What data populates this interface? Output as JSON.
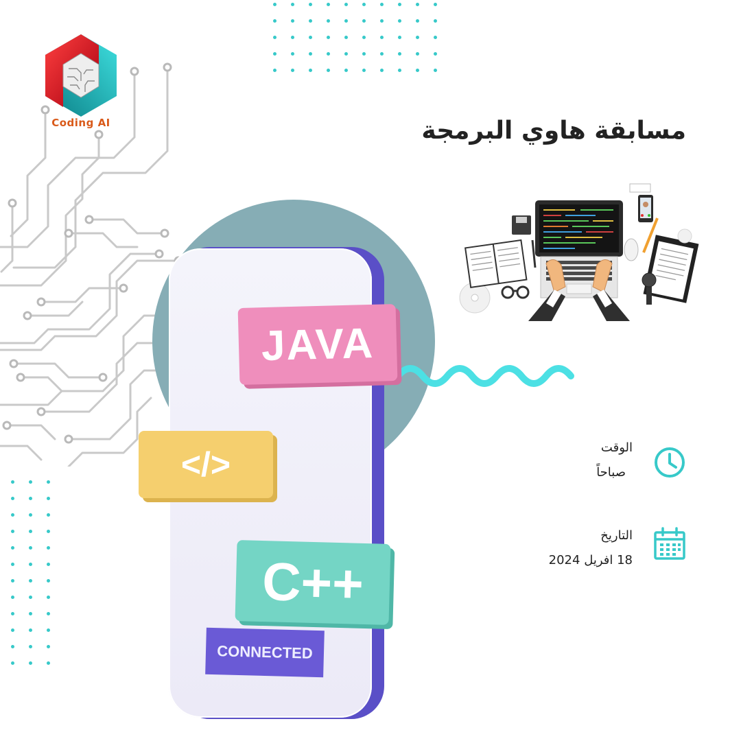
{
  "brand": {
    "logo_text": "Coding AI"
  },
  "title": "مسابقة هاوي البرمجة",
  "phone": {
    "chips": {
      "java": "JAVA",
      "code": "</>",
      "cpp": "C++"
    },
    "badge": "CONNECTED"
  },
  "details": {
    "time_label": "الوقت",
    "time_value": "صباحاً",
    "date_label": "التاريخ",
    "date_value": "18 افريل 2024"
  },
  "colors": {
    "accent_teal": "#37c9c9",
    "circle": "#86adb5",
    "phone_edge": "#5a4fc7",
    "java": "#ef8ebc",
    "code": "#f5cf6e",
    "cpp": "#74d5c5",
    "badge": "#6a5ad6"
  },
  "icons": [
    "logo-icon",
    "circuit-board-decoration",
    "clock-icon",
    "calendar-icon",
    "wave-decoration",
    "laptop-workspace-illustration"
  ]
}
